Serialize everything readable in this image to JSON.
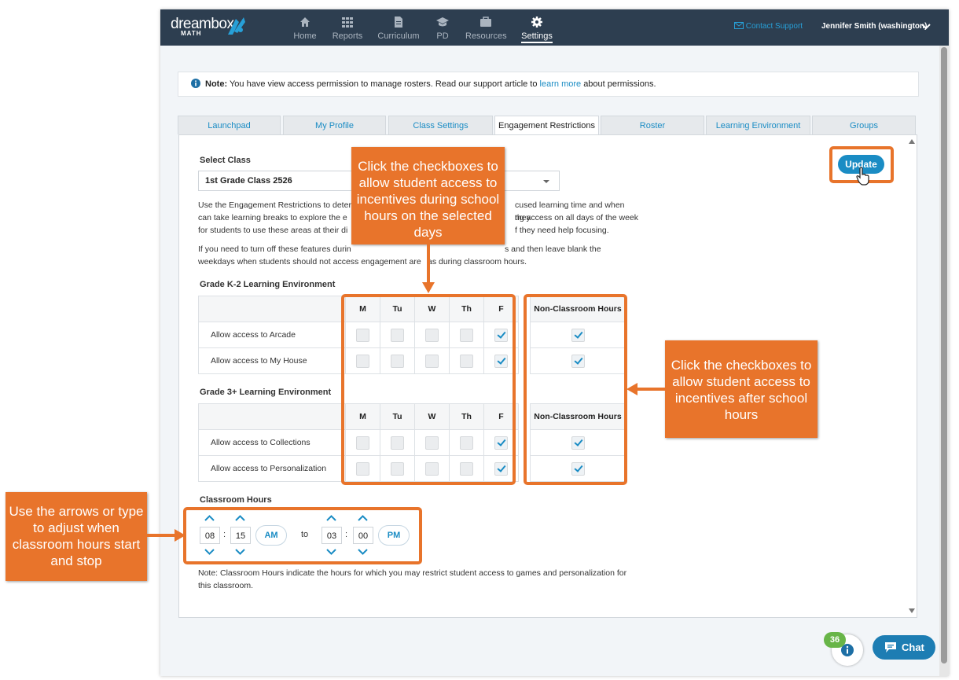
{
  "header": {
    "logo_text": "dreambox",
    "logo_sub": "MATH",
    "nav": [
      {
        "label": "Home",
        "icon": "home-icon"
      },
      {
        "label": "Reports",
        "icon": "grid-icon"
      },
      {
        "label": "Curriculum",
        "icon": "document-icon"
      },
      {
        "label": "PD",
        "icon": "graduation-cap-icon"
      },
      {
        "label": "Resources",
        "icon": "briefcase-icon"
      },
      {
        "label": "Settings",
        "icon": "gear-icon"
      }
    ],
    "active_nav": "Settings",
    "contact_support": "Contact Support",
    "user_name": "Jennifer Smith (washington)"
  },
  "note": {
    "prefix": "Note:",
    "text_before_link": "You have view access permission to manage rosters. Read our support article to",
    "link_text": "learn more",
    "text_after_link": "about permissions."
  },
  "tabs": [
    {
      "label": "Launchpad"
    },
    {
      "label": "My Profile"
    },
    {
      "label": "Class Settings"
    },
    {
      "label": "Engagement Restrictions"
    },
    {
      "label": "Roster"
    },
    {
      "label": "Learning Environment"
    },
    {
      "label": "Groups"
    }
  ],
  "active_tab": "Engagement Restrictions",
  "form": {
    "select_class_label": "Select Class",
    "selected_class": "1st Grade Class 2526",
    "para1_lines": [
      "Use the Engagement Restrictions to deter",
      "can take learning breaks to explore the e",
      "for students to use these areas at their di",
      "cused learning time and when they",
      "ng access on all days of the week",
      "f they need help focusing."
    ],
    "para2_lines": [
      "If you need to turn off these features durin",
      "weekdays when students should not access engagement are",
      "s and then leave blank the",
      "as during classroom hours."
    ],
    "update_label": "Update",
    "days": [
      "M",
      "Tu",
      "W",
      "Th",
      "F"
    ],
    "non_classroom_header": "Non-Classroom Hours",
    "sections": [
      {
        "title": "Grade K-2 Learning Environment",
        "rows": [
          {
            "label": "Allow access to Arcade",
            "days": [
              false,
              false,
              false,
              false,
              true
            ],
            "non_classroom": true
          },
          {
            "label": "Allow access to My House",
            "days": [
              false,
              false,
              false,
              false,
              true
            ],
            "non_classroom": true
          }
        ]
      },
      {
        "title": "Grade 3+ Learning Environment",
        "rows": [
          {
            "label": "Allow access to Collections",
            "days": [
              false,
              false,
              false,
              false,
              true
            ],
            "non_classroom": true
          },
          {
            "label": "Allow access to Personalization",
            "days": [
              false,
              false,
              false,
              false,
              true
            ],
            "non_classroom": true
          }
        ]
      }
    ],
    "classroom_hours_label": "Classroom Hours",
    "start": {
      "hour": "08",
      "minute": "15",
      "ampm": "AM"
    },
    "to_label": "to",
    "end": {
      "hour": "03",
      "minute": "00",
      "ampm": "PM"
    },
    "colon": ":",
    "footnote_line1": "Note: Classroom Hours indicate the hours for which you may restrict student access to games and personalization for",
    "footnote_line2": "this classroom."
  },
  "callouts": {
    "school_hours": "Click the checkboxes to allow student access to incentives during school hours on the selected days",
    "after_hours": "Click the checkboxes to allow student access to incentives after school hours",
    "time": "Use the arrows or type to adjust when classroom hours start and stop"
  },
  "widgets": {
    "help_badge_count": "36",
    "chat_label": "Chat"
  },
  "colors": {
    "header_bg": "#2d3e50",
    "accent": "#1a8cc4",
    "callout": "#e8742b",
    "badge": "#68b548"
  }
}
